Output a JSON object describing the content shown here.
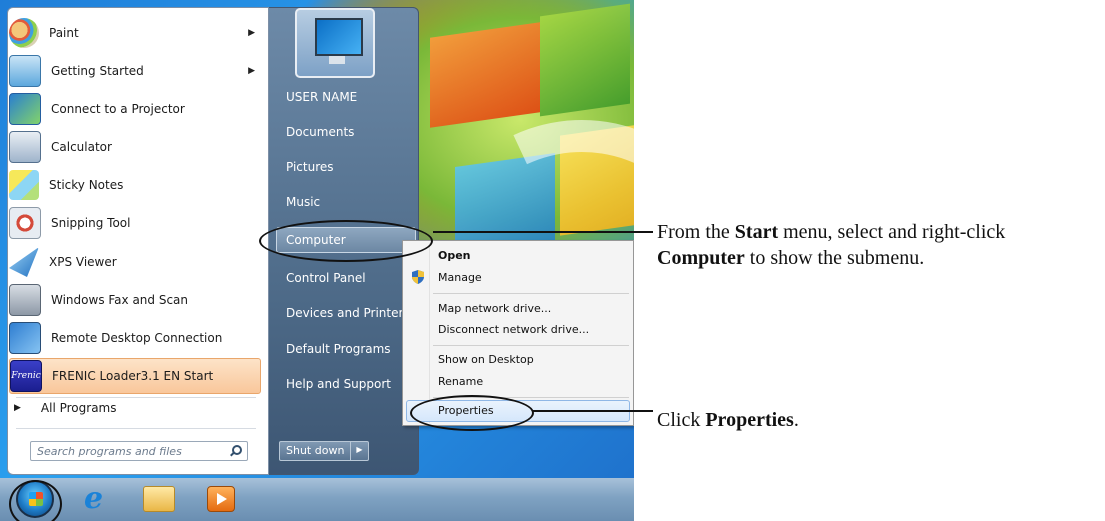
{
  "start_menu": {
    "programs": [
      {
        "label": "Paint",
        "icon": "paint-icon",
        "has_submenu": true
      },
      {
        "label": "Getting Started",
        "icon": "getting-started-icon",
        "has_submenu": true
      },
      {
        "label": "Connect to a Projector",
        "icon": "projector-icon",
        "has_submenu": false
      },
      {
        "label": "Calculator",
        "icon": "calculator-icon",
        "has_submenu": false
      },
      {
        "label": "Sticky Notes",
        "icon": "sticky-notes-icon",
        "has_submenu": false
      },
      {
        "label": "Snipping Tool",
        "icon": "snipping-tool-icon",
        "has_submenu": false
      },
      {
        "label": "XPS Viewer",
        "icon": "xps-viewer-icon",
        "has_submenu": false
      },
      {
        "label": "Windows Fax and Scan",
        "icon": "fax-scan-icon",
        "has_submenu": false
      },
      {
        "label": "Remote Desktop Connection",
        "icon": "remote-desktop-icon",
        "has_submenu": false
      },
      {
        "label": "FRENIC Loader3.1 EN Start",
        "icon": "frenic-loader-icon",
        "has_submenu": false,
        "highlighted": true
      }
    ],
    "frenic_icon_text": "Frenic",
    "all_programs": "All Programs",
    "search_placeholder": "Search programs and files",
    "right_links": {
      "user_name": "USER NAME",
      "documents": "Documents",
      "pictures": "Pictures",
      "music": "Music",
      "computer": "Computer",
      "control_panel": "Control Panel",
      "devices_printers": "Devices and Printers",
      "default_programs": "Default Programs",
      "help_support": "Help and Support"
    },
    "shutdown_label": "Shut down"
  },
  "context_menu": {
    "open": "Open",
    "manage": "Manage",
    "map_drive": "Map network drive...",
    "disconnect_drive": "Disconnect network drive...",
    "show_desktop": "Show on Desktop",
    "rename": "Rename",
    "properties": "Properties"
  },
  "taskbar": {
    "icons": [
      "start-orb-icon",
      "internet-explorer-icon",
      "file-explorer-icon",
      "media-player-icon"
    ]
  },
  "callouts": {
    "step1_pre": "From the ",
    "step1_bold1": "Start",
    "step1_mid": " menu, select and right-click",
    "step1_bold2": "Computer",
    "step1_post": " to show the submenu.",
    "step2_pre": "Click ",
    "step2_bold": "Properties",
    "step2_post": "."
  },
  "colors": {
    "highlight_orange": "#f9c79b",
    "menu_blue": "#4e6b89",
    "callout_black": "#111111"
  }
}
